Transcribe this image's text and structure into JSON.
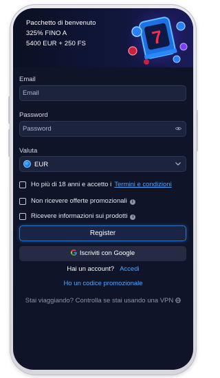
{
  "banner": {
    "line1": "Pacchetto di benvenuto",
    "line2": "325% FINO A",
    "line3": "5400 EUR + 250 FS",
    "art_icon": "slot-machine-icon"
  },
  "form": {
    "email_label": "Email",
    "email_placeholder": "Email",
    "password_label": "Password",
    "password_placeholder": "Password",
    "currency_label": "Valuta",
    "currency_value": "EUR",
    "age_text": "Ho più di 18 anni e accetto i",
    "terms_link": "Termini e condizioni",
    "no_promo_text": "Non ricevere offerte promozionali",
    "product_info_text": "Ricevere informazioni sui prodotti",
    "register_label": "Register",
    "google_label": "Iscriviti con Google",
    "have_account_text": "Hai un account?",
    "login_link": "Accedi",
    "promo_code_link": "Ho un codice promozionale",
    "vpn_text": "Stai viaggiando? Controlla se stai usando una VPN"
  },
  "colors": {
    "background": "#0f1428",
    "field": "#1c233d",
    "link": "#4aa6ff",
    "register_border": "#2d74c9"
  }
}
